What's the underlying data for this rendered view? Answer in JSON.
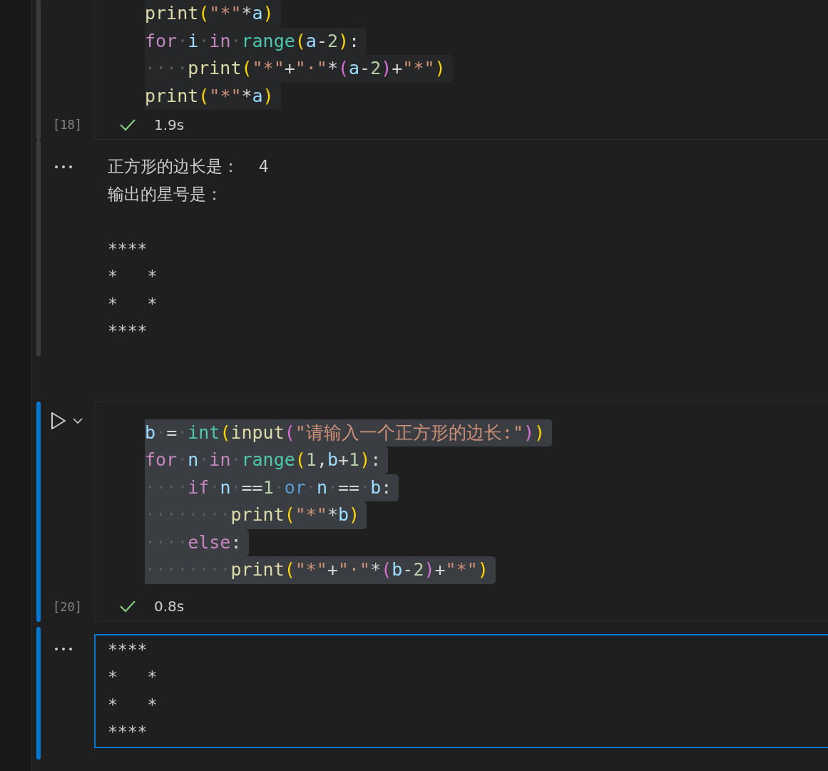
{
  "cells": [
    {
      "focused": false,
      "execution_count": "[18]",
      "duration": "1.9s",
      "code": [
        [
          {
            "text": "print",
            "kind": "fn"
          },
          {
            "text": "(",
            "kind": "p1"
          },
          {
            "text": "\"*\"",
            "kind": "str"
          },
          {
            "text": "*",
            "kind": "op"
          },
          {
            "text": "a",
            "kind": "var"
          },
          {
            "text": ")",
            "kind": "p1"
          }
        ],
        [
          {
            "text": "for",
            "kind": "kw"
          },
          {
            "text": "·",
            "kind": "ws"
          },
          {
            "text": "i",
            "kind": "var"
          },
          {
            "text": "·",
            "kind": "ws"
          },
          {
            "text": "in",
            "kind": "kw"
          },
          {
            "text": "·",
            "kind": "ws"
          },
          {
            "text": "range",
            "kind": "cls"
          },
          {
            "text": "(",
            "kind": "p1"
          },
          {
            "text": "a",
            "kind": "var"
          },
          {
            "text": "-",
            "kind": "op"
          },
          {
            "text": "2",
            "kind": "num"
          },
          {
            "text": ")",
            "kind": "p1"
          },
          {
            "text": ":",
            "kind": "op"
          }
        ],
        [
          {
            "text": "····",
            "kind": "ws"
          },
          {
            "text": "print",
            "kind": "fn"
          },
          {
            "text": "(",
            "kind": "p1"
          },
          {
            "text": "\"*\"",
            "kind": "str"
          },
          {
            "text": "+",
            "kind": "op"
          },
          {
            "text": "\"·\"",
            "kind": "str"
          },
          {
            "text": "*",
            "kind": "op"
          },
          {
            "text": "(",
            "kind": "p2"
          },
          {
            "text": "a",
            "kind": "var"
          },
          {
            "text": "-",
            "kind": "op"
          },
          {
            "text": "2",
            "kind": "num"
          },
          {
            "text": ")",
            "kind": "p2"
          },
          {
            "text": "+",
            "kind": "op"
          },
          {
            "text": "\"*\"",
            "kind": "str"
          },
          {
            "text": ")",
            "kind": "p1"
          }
        ],
        [
          {
            "text": "print",
            "kind": "fn"
          },
          {
            "text": "(",
            "kind": "p1"
          },
          {
            "text": "\"*\"",
            "kind": "str"
          },
          {
            "text": "*",
            "kind": "op"
          },
          {
            "text": "a",
            "kind": "var"
          },
          {
            "text": ")",
            "kind": "p1"
          }
        ]
      ],
      "output": "正方形的边长是：  4\n输出的星号是：\n\n****\n*   *\n*   *\n****"
    },
    {
      "focused": true,
      "execution_count": "[20]",
      "duration": "0.8s",
      "code": [
        [
          {
            "text": "b",
            "kind": "var"
          },
          {
            "text": "·",
            "kind": "ws"
          },
          {
            "text": "=",
            "kind": "op"
          },
          {
            "text": "·",
            "kind": "ws"
          },
          {
            "text": "int",
            "kind": "cls"
          },
          {
            "text": "(",
            "kind": "p1"
          },
          {
            "text": "input",
            "kind": "fn"
          },
          {
            "text": "(",
            "kind": "p2"
          },
          {
            "text": "\"请输入一个正方形的边长:\"",
            "kind": "str"
          },
          {
            "text": ")",
            "kind": "p2"
          },
          {
            "text": ")",
            "kind": "p1"
          }
        ],
        [
          {
            "text": "for",
            "kind": "kw"
          },
          {
            "text": "·",
            "kind": "ws"
          },
          {
            "text": "n",
            "kind": "var"
          },
          {
            "text": "·",
            "kind": "ws"
          },
          {
            "text": "in",
            "kind": "kw"
          },
          {
            "text": "·",
            "kind": "ws"
          },
          {
            "text": "range",
            "kind": "cls"
          },
          {
            "text": "(",
            "kind": "p1"
          },
          {
            "text": "1",
            "kind": "num"
          },
          {
            "text": ",",
            "kind": "op"
          },
          {
            "text": "b",
            "kind": "var"
          },
          {
            "text": "+",
            "kind": "op"
          },
          {
            "text": "1",
            "kind": "num"
          },
          {
            "text": ")",
            "kind": "p1"
          },
          {
            "text": ":",
            "kind": "op"
          }
        ],
        [
          {
            "text": "····",
            "kind": "ws"
          },
          {
            "text": "if",
            "kind": "kw"
          },
          {
            "text": "·",
            "kind": "ws"
          },
          {
            "text": "n",
            "kind": "var"
          },
          {
            "text": "·",
            "kind": "ws"
          },
          {
            "text": "==",
            "kind": "op"
          },
          {
            "text": "1",
            "kind": "num"
          },
          {
            "text": "·",
            "kind": "ws"
          },
          {
            "text": "or",
            "kind": "kw2"
          },
          {
            "text": "·",
            "kind": "ws"
          },
          {
            "text": "n",
            "kind": "var"
          },
          {
            "text": "·",
            "kind": "ws"
          },
          {
            "text": "==",
            "kind": "op"
          },
          {
            "text": "·",
            "kind": "ws"
          },
          {
            "text": "b",
            "kind": "var"
          },
          {
            "text": ":",
            "kind": "op"
          }
        ],
        [
          {
            "text": "········",
            "kind": "ws"
          },
          {
            "text": "print",
            "kind": "fn"
          },
          {
            "text": "(",
            "kind": "p1"
          },
          {
            "text": "\"*\"",
            "kind": "str"
          },
          {
            "text": "*",
            "kind": "op"
          },
          {
            "text": "b",
            "kind": "var"
          },
          {
            "text": ")",
            "kind": "p1"
          }
        ],
        [
          {
            "text": "····",
            "kind": "ws"
          },
          {
            "text": "else",
            "kind": "kw"
          },
          {
            "text": ":",
            "kind": "op"
          }
        ],
        [
          {
            "text": "········",
            "kind": "ws"
          },
          {
            "text": "print",
            "kind": "fn"
          },
          {
            "text": "(",
            "kind": "p1"
          },
          {
            "text": "\"*\"",
            "kind": "str"
          },
          {
            "text": "+",
            "kind": "op"
          },
          {
            "text": "\"·\"",
            "kind": "str"
          },
          {
            "text": "*",
            "kind": "op"
          },
          {
            "text": "(",
            "kind": "p2"
          },
          {
            "text": "b",
            "kind": "var"
          },
          {
            "text": "-",
            "kind": "op"
          },
          {
            "text": "2",
            "kind": "num"
          },
          {
            "text": ")",
            "kind": "p2"
          },
          {
            "text": "+",
            "kind": "op"
          },
          {
            "text": "\"*\"",
            "kind": "str"
          },
          {
            "text": ")",
            "kind": "p1"
          }
        ]
      ],
      "output": "****\n*   *\n*   *\n****"
    }
  ]
}
